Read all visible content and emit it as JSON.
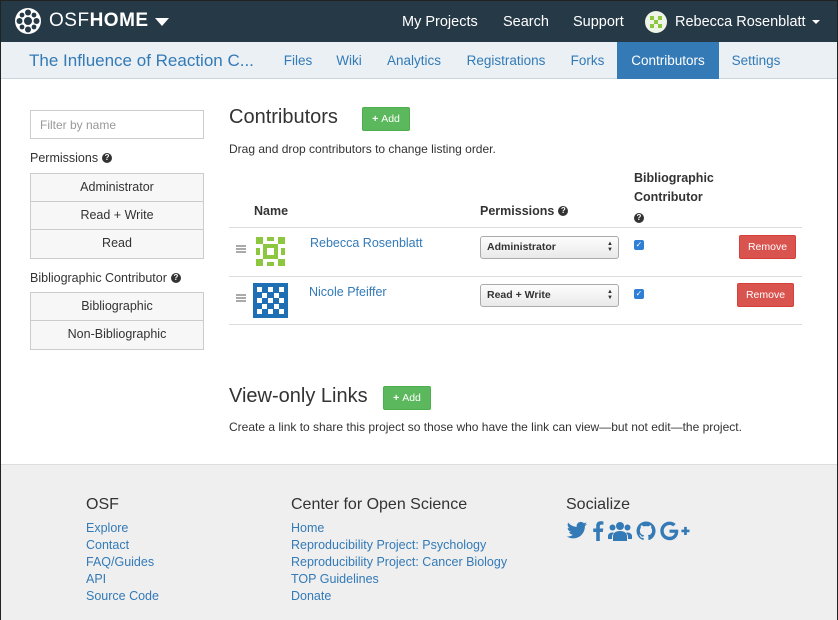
{
  "navbar": {
    "brand_osf": "OSF",
    "brand_home": "HOME",
    "links": [
      "My Projects",
      "Search",
      "Support"
    ],
    "user_name": "Rebecca Rosenblatt"
  },
  "project_nav": {
    "title": "The Influence of Reaction C...",
    "tabs": [
      "Files",
      "Wiki",
      "Analytics",
      "Registrations",
      "Forks",
      "Contributors",
      "Settings"
    ],
    "active_tab": "Contributors"
  },
  "filters": {
    "search_placeholder": "Filter by name",
    "permissions_label": "Permissions",
    "permission_options": [
      "Administrator",
      "Read + Write",
      "Read"
    ],
    "bibliographic_label": "Bibliographic Contributor",
    "bibliographic_options": [
      "Bibliographic",
      "Non-Bibliographic"
    ]
  },
  "contributors": {
    "heading": "Contributors",
    "add_label": "Add",
    "instructions": "Drag and drop contributors to change listing order.",
    "col_name": "Name",
    "col_permissions": "Permissions",
    "col_bibliographic_1": "Bibliographic",
    "col_bibliographic_2": "Contributor",
    "remove_label": "Remove",
    "rows": [
      {
        "name": "Rebecca Rosenblatt",
        "permission": "Administrator",
        "bibliographic": true
      },
      {
        "name": "Nicole Pfeiffer",
        "permission": "Read + Write",
        "bibliographic": true
      }
    ]
  },
  "view_only": {
    "heading": "View-only Links",
    "add_label": "Add",
    "description": "Create a link to share this project so those who have the link can view—but not edit—the project."
  },
  "footer": {
    "osf_heading": "OSF",
    "osf_links": [
      "Explore",
      "Contact",
      "FAQ/Guides",
      "API",
      "Source Code"
    ],
    "cos_heading": "Center for Open Science",
    "cos_links": [
      "Home",
      "Reproducibility Project: Psychology",
      "Reproducibility Project: Cancer Biology",
      "TOP Guidelines",
      "Donate"
    ],
    "social_heading": "Socialize",
    "social_icons": [
      "twitter-icon",
      "facebook-icon",
      "group-icon",
      "github-icon",
      "google-plus-icon"
    ]
  },
  "colors": {
    "navbar": "#263947",
    "link": "#337ab7",
    "success": "#5cb85c",
    "danger": "#d9534f"
  }
}
